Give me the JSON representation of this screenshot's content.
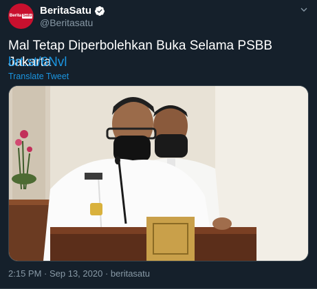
{
  "colors": {
    "background": "#15202b",
    "text": "#ffffff",
    "secondary_text": "#8899a6",
    "link": "#1b95e0",
    "brand": "#c8102e"
  },
  "author": {
    "avatar_logo_main": "Berita",
    "avatar_logo_sub": "Satu",
    "display_name": "BeritaSatu",
    "verified_icon": "verified-badge-icon",
    "handle": "@Beritasatu"
  },
  "menu_icon": "chevron-down-icon",
  "tweet": {
    "text": "Mal Tetap Diperbolehkan Buka Selama PSBB Jakarta",
    "link": "brt.st/6Nvl",
    "translate_label": "Translate Tweet"
  },
  "media": {
    "type": "photo",
    "alt": ""
  },
  "meta": {
    "time": "2:15 PM",
    "separator1": " · ",
    "date": "Sep 13, 2020",
    "separator2": " · ",
    "source": "beritasatu"
  }
}
